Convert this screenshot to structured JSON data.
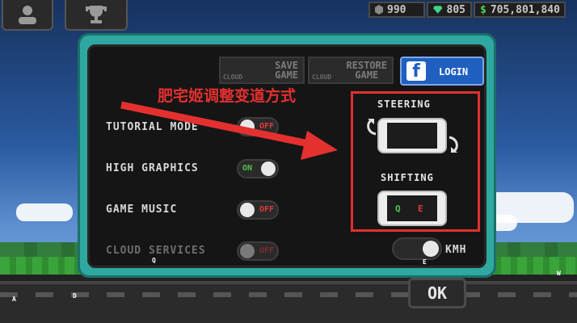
{
  "top": {
    "currency1": "990",
    "currency2": "805",
    "money": "705,801,840",
    "colors": {
      "gem": "#3fd28a",
      "money": "#58d04e",
      "coin": "#9a9a9a"
    }
  },
  "dialog": {
    "save_game": {
      "line1": "SAVE",
      "line2": "GAME",
      "sub": "CLOUD"
    },
    "restore_game": {
      "line1": "RESTORE",
      "line2": "GAME",
      "sub": "CLOUD"
    },
    "login": {
      "logo": "f",
      "label": "LOGIN"
    },
    "options": [
      {
        "label": "TUTORIAL MODE",
        "state": "OFF"
      },
      {
        "label": "HIGH GRAPHICS",
        "state": "ON"
      },
      {
        "label": "GAME MUSIC",
        "state": "OFF"
      },
      {
        "label": "CLOUD SERVICES",
        "state": "OFF"
      }
    ],
    "steering_title": "STEERING",
    "shifting_title": "SHIFTING",
    "shift_left": "Q",
    "shift_right": "E",
    "unit_label": "KMH",
    "ok_label": "OK"
  },
  "annotation": {
    "text": "肥宅姬调整变道方式",
    "color": "#e03030"
  },
  "key_hints": {
    "q": "Q",
    "e": "E",
    "w": "W",
    "a": "A",
    "d": "D"
  }
}
